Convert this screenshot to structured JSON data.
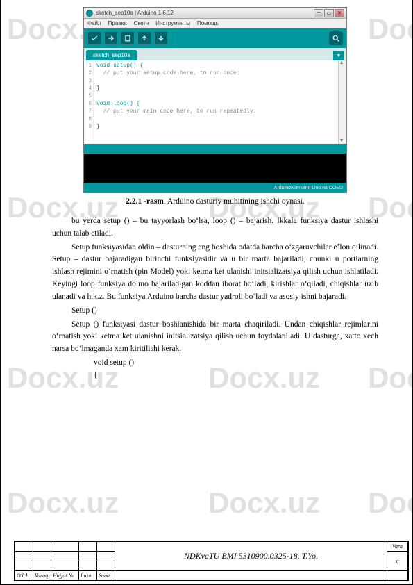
{
  "watermark": "Docx.uz",
  "arduino": {
    "title": "sketch_sep10a | Arduino 1.6.12",
    "menu": [
      "Файл",
      "Правка",
      "Скетч",
      "Инструменты",
      "Помощь"
    ],
    "tab": "sketch_sep10a",
    "code_lines": {
      "l1": "void setup() {",
      "l2": "  // put your setup code here, to run once:",
      "l3": "",
      "l4": "}",
      "l5": "",
      "l6": "void loop() {",
      "l7": "  // put your main code here, to run repeatedly:",
      "l8": "",
      "l9": "}"
    },
    "line_numbers": [
      "1",
      "2",
      "3",
      "4",
      "5",
      "6",
      "7",
      "8",
      "9"
    ],
    "status_right": "Arduino/Genuino Uno на COM3"
  },
  "caption_label": "2.2.1 -rasm",
  "caption_text": ". Arduino dasturiy muhitining ishchi oynasi.",
  "paragraphs": {
    "p1": "bu yerda setup () – bu tayyorlash boʻlsa, loop () – bajarish. Ikkala funksiya dastur ishlashi uchun talab etiladi.",
    "p2": "Setup funksiyasidan oldin – dasturning eng boshida odatda barcha oʻzgaruvchilar eʼlon qilinadi. Setup – dastur bajaradigan birinchi funksiyasidir va u bir marta bajariladi, chunki u portlarning ishlash rejimini oʻrnatish (pin Model) yoki ketma ket ulanishi initsializatsiya qilish uchun ishlatiladi. Keyingi loop funksiya doimo bajariladigan koddan iborat boʻladi, kirishlar oʻqiladi, chiqishlar uzib ulanadi va h.k.z. Bu funksiya Arduino barcha dastur yadroli boʻladi va asosiy ishni bajaradi.",
    "p3": "Setup ()",
    "p4": "Setup () funksiyasi dastur boshlanishida bir marta chaqiriladi. Undan chiqishlar rejimlarini oʻrnatish yoki ketma ket ulanishni initsializatsiya qilish uchun foydalaniladi. U dasturga, xatto xech narsa boʻlmaganda xam kiritilishi kerak.",
    "c1": "void setup ()",
    "c2": "{"
  },
  "stamp": {
    "col1": "O'lch",
    "col2": "Varaq",
    "col3": "Hujjat №",
    "col4": "Imzo",
    "col5": "Sana",
    "title": "NDKvaTU BMI 5310900.0325-18. T.Yo.",
    "vara": "Vara",
    "q": "q"
  }
}
